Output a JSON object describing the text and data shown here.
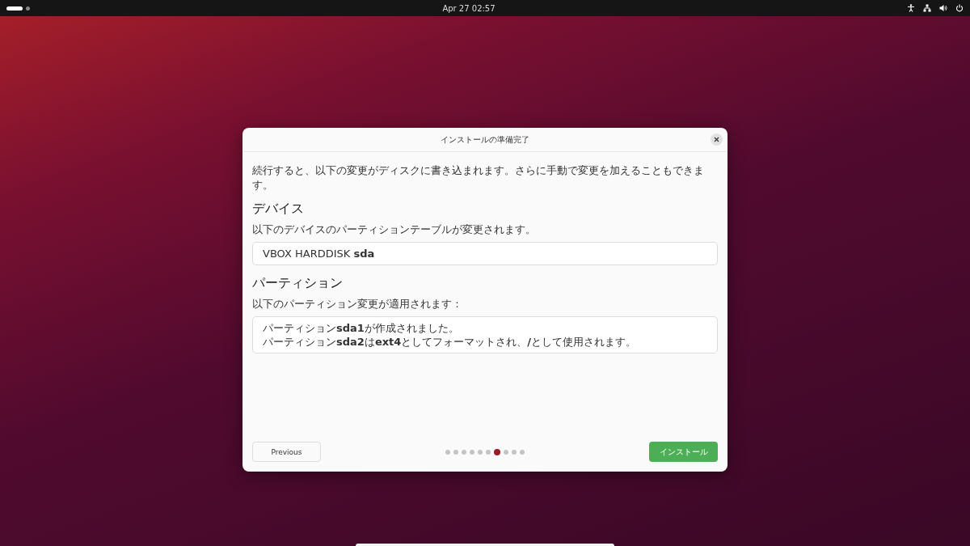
{
  "top_bar": {
    "clock": "Apr 27  02:57",
    "workspaces": [
      {
        "selected": true
      },
      {
        "selected": false
      }
    ]
  },
  "dialog": {
    "title": "インストールの準備完了",
    "intro": "続行すると、以下の変更がディスクに書き込まれます。さらに手動で変更を加えることもできます。",
    "sections": [
      {
        "heading": "デバイス",
        "description": "以下のデバイスのパーティションテーブルが変更されます。",
        "lines": [
          "VBOX HARDDISK **sda**"
        ]
      },
      {
        "heading": "パーティション",
        "description": "以下のパーティション変更が適用されます：",
        "lines": [
          "パーティション**sda1**が作成されました。",
          "パーティション**sda2**は**ext4**としてフォーマットされ、**/**として使用されます。"
        ]
      }
    ],
    "previous_button": "Previous",
    "steps": [
      {
        "selected": false
      },
      {
        "selected": false
      },
      {
        "selected": false
      },
      {
        "selected": false
      },
      {
        "selected": false
      },
      {
        "selected": false
      },
      {
        "selected": true
      },
      {
        "selected": false
      },
      {
        "selected": false
      },
      {
        "selected": false
      }
    ],
    "install_button": "インストール"
  }
}
